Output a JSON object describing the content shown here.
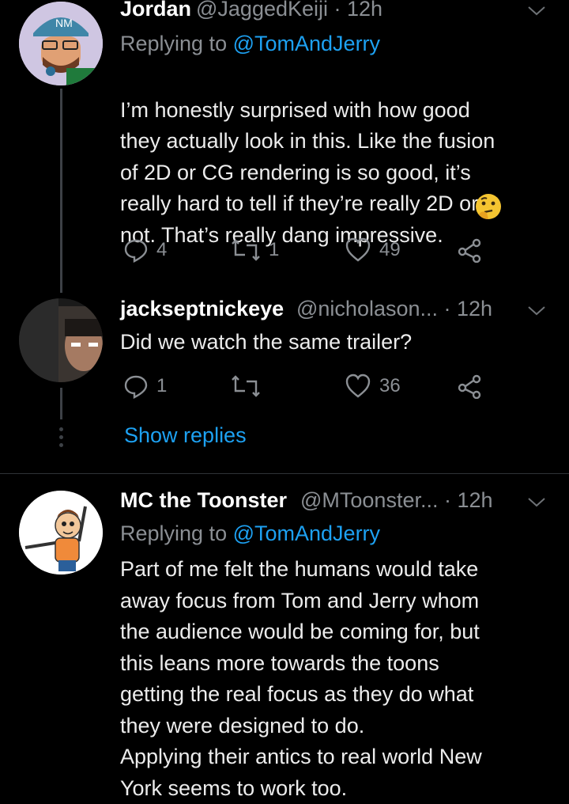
{
  "tweet1": {
    "name": "Jordan",
    "handle": "@JaggedKeiji · 12h",
    "replying_prefix": "Replying to ",
    "replying_to": "@TomAndJerry",
    "text": "I’m honestly surprised with how good\nthey actually look in this. Like the fusion\nof 2D or CG rendering is so good, it’s\nreally hard to tell if they’re really 2D or\nnot. That’s really dang impressive.",
    "emoji": "thinking-face",
    "reply_count": "4",
    "retweet_count": "1",
    "like_count": "49"
  },
  "tweet2": {
    "name": "jackseptnickeye",
    "handle": "@nicholason... · 12h",
    "text": "Did we watch the same trailer?",
    "reply_count": "1",
    "retweet_count": "",
    "like_count": "36",
    "show_replies": "Show replies"
  },
  "tweet3": {
    "name": "MC the Toonster",
    "handle": "@MToonster... · 12h",
    "replying_prefix": "Replying to ",
    "replying_to": "@TomAndJerry",
    "text": "Part of me felt the humans would take\naway focus from Tom and Jerry whom\nthe audience would be coming for, but\nthis leans more towards the toons\ngetting the real focus as they do what\nthey were designed to do.\nApplying their antics to real world New\nYork seems to work too."
  },
  "colors": {
    "background": "#000000",
    "text": "#ececec",
    "secondary": "#8b8f94",
    "link": "#1da1f2"
  }
}
